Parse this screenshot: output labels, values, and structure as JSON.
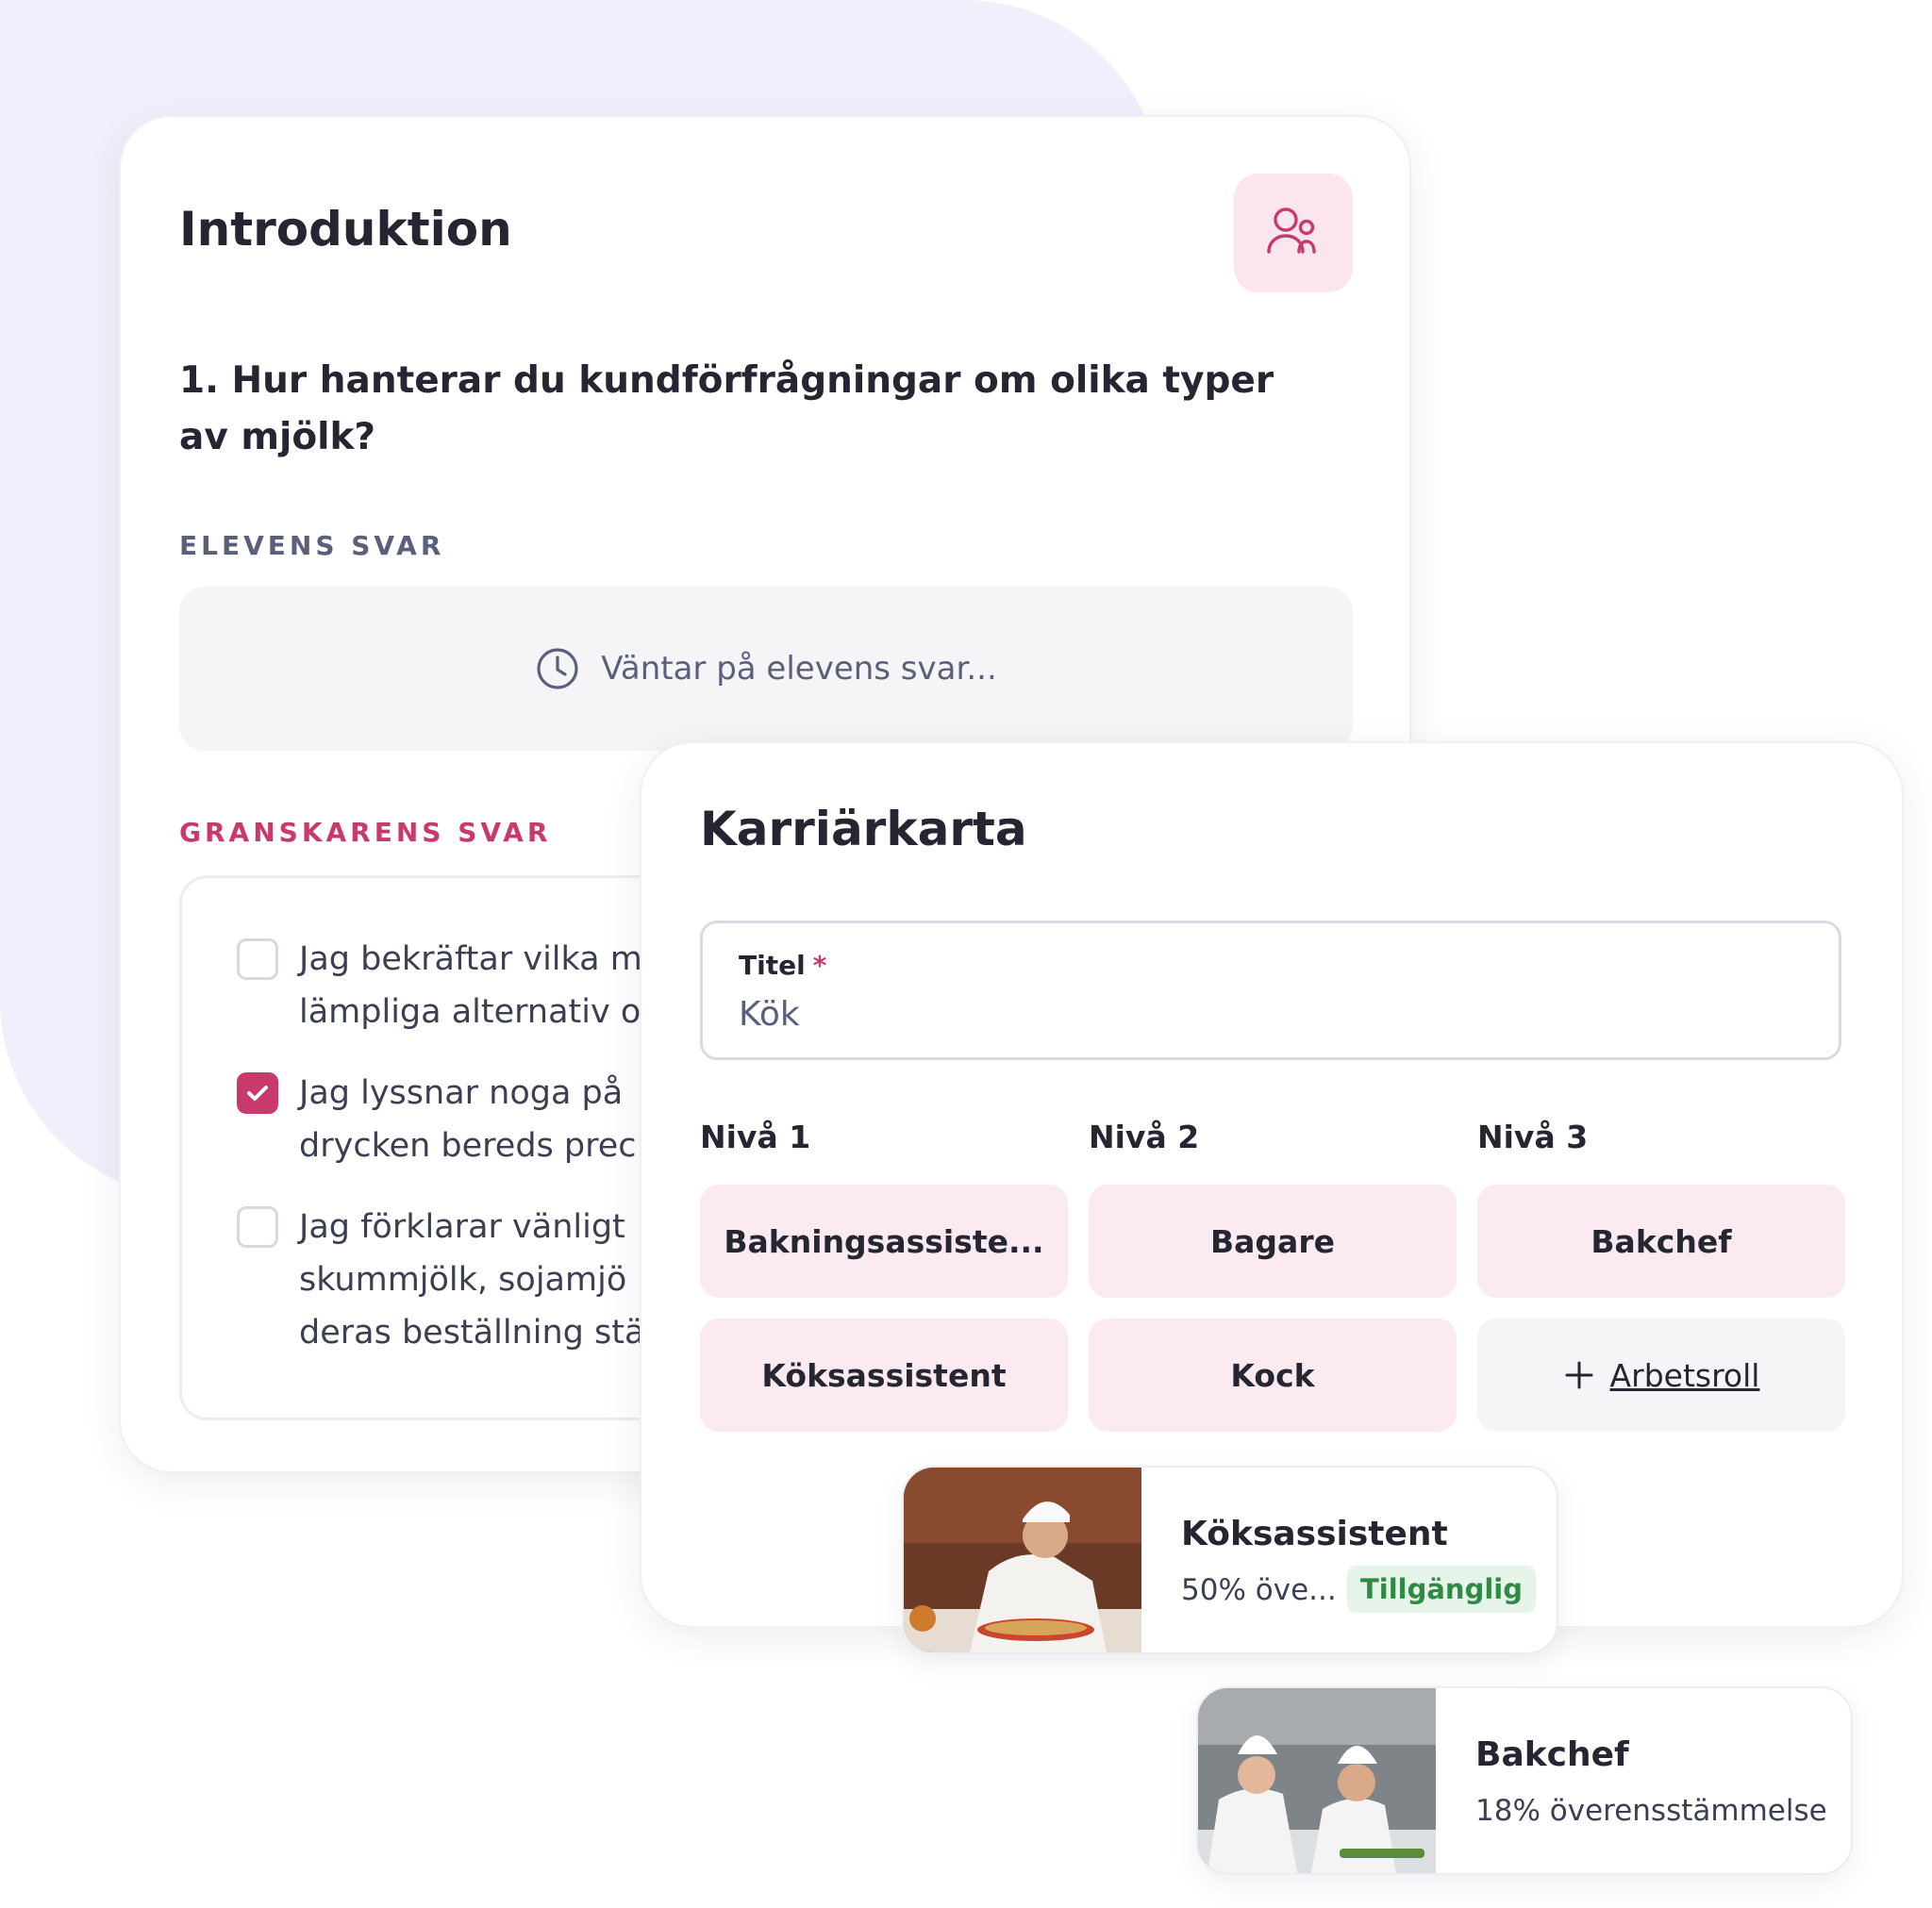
{
  "intro": {
    "title": "Introduktion",
    "question": "1. Hur hanterar du kundförfrågningar om olika typer av mjölk?",
    "student_label": "ELEVENS SVAR",
    "waiting_text": "Väntar på elevens svar...",
    "reviewer_label": "GRANSKARENS SVAR",
    "checklist": [
      {
        "text": "Jag bekräftar vilka m lämpliga alternativ o",
        "checked": false
      },
      {
        "text": "Jag lyssnar noga på drycken bereds prec",
        "checked": true
      },
      {
        "text": "Jag förklarar vänligt skummjölk, sojamjö deras beställning stä",
        "checked": false
      }
    ]
  },
  "career": {
    "title": "Karriärkarta",
    "field_label": "Titel",
    "required_mark": "*",
    "field_value": "Kök",
    "levels": [
      "Nivå 1",
      "Nivå 2",
      "Nivå 3"
    ],
    "roles_row1": [
      "Bakningsassiste...",
      "Bagare",
      "Bakchef"
    ],
    "roles_row2": [
      "Köksassistent",
      "Kock"
    ],
    "add_role_label": "Arbetsroll"
  },
  "matches": [
    {
      "name": "Köksassistent",
      "percent": "50% öve...",
      "badge": "Tillgänglig"
    },
    {
      "name": "Bakchef",
      "percent": "18% överensstämmelse"
    }
  ],
  "colors": {
    "accent": "#c8396c",
    "accent_light": "#fbeaf0",
    "background_blob": "#f2effc",
    "badge_green": "#2f8a45"
  },
  "icons": [
    "people-icon",
    "clock-icon",
    "check-icon",
    "plus-icon"
  ]
}
